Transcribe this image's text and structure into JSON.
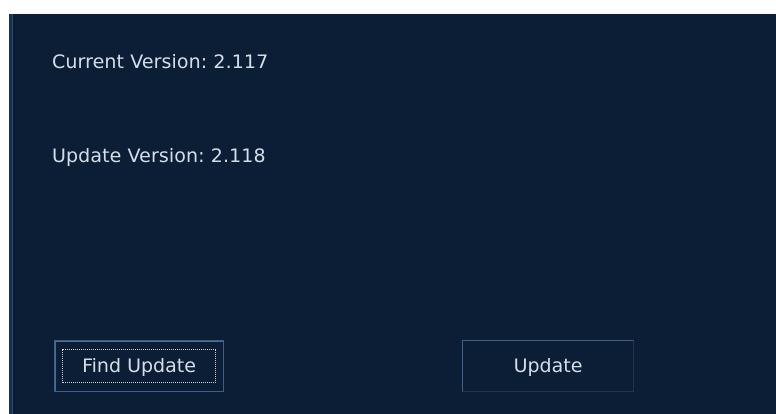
{
  "versions": {
    "current_label": "Current Version: 2.117",
    "update_label": "Update Version: 2.118"
  },
  "buttons": {
    "find_update": "Find Update",
    "update": "Update"
  },
  "colors": {
    "panel_background": "#0b1e35",
    "text": "#d4dde8",
    "button_border": "#3f5f84"
  }
}
